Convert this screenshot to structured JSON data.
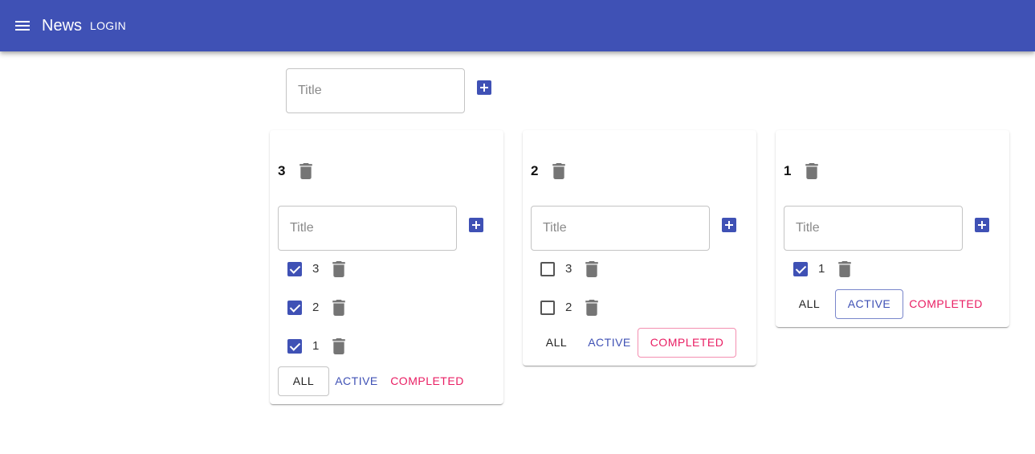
{
  "appbar": {
    "title": "News",
    "login_label": "LOGIN",
    "menu_icon": "menu-icon",
    "color": "#3f51b5"
  },
  "new_todolist": {
    "placeholder": "Title",
    "value": "",
    "add_icon": "add-box-icon"
  },
  "filters_labels": {
    "all": "ALL",
    "active": "ACTIVE",
    "completed": "COMPLETED"
  },
  "todolists": [
    {
      "title": "3",
      "input_placeholder": "Title",
      "tasks": [
        {
          "label": "3",
          "checked": true
        },
        {
          "label": "2",
          "checked": true
        },
        {
          "label": "1",
          "checked": true
        }
      ],
      "selected_filter": "all"
    },
    {
      "title": "2",
      "input_placeholder": "Title",
      "tasks": [
        {
          "label": "3",
          "checked": false
        },
        {
          "label": "2",
          "checked": false
        }
      ],
      "selected_filter": "completed"
    },
    {
      "title": "1",
      "input_placeholder": "Title",
      "tasks": [
        {
          "label": "1",
          "checked": true
        }
      ],
      "selected_filter": "active"
    }
  ],
  "colors": {
    "primary": "#3f51b5",
    "secondary": "#e91e63",
    "icon_grey": "#757575"
  }
}
